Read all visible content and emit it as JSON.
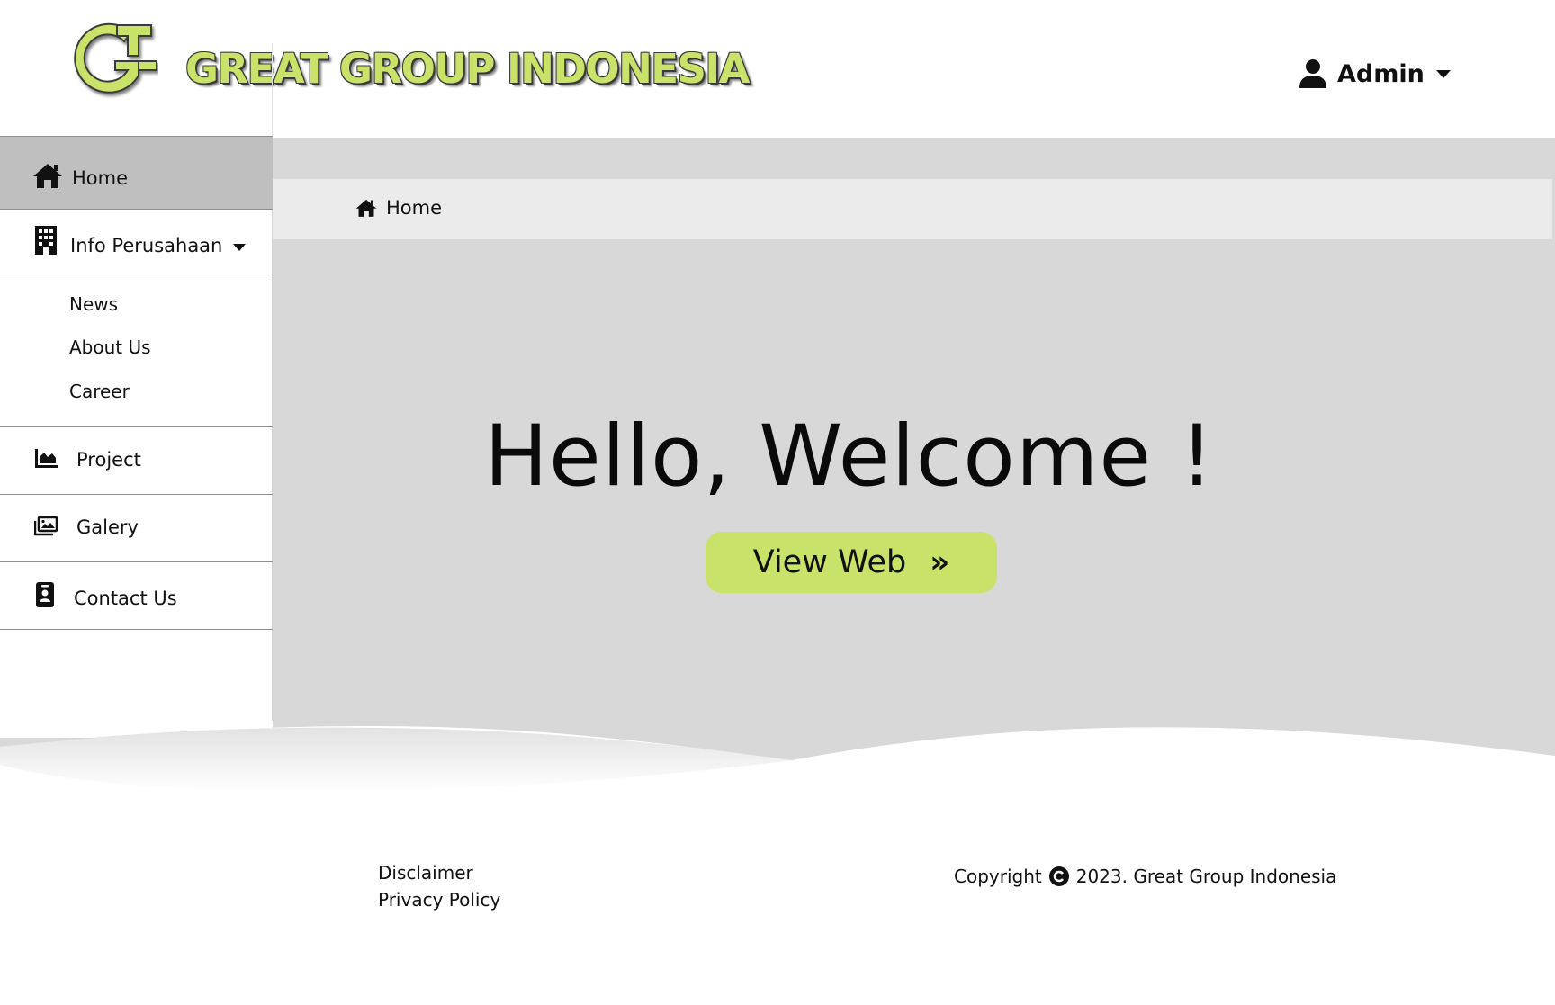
{
  "header": {
    "brand_name": "GREAT GROUP INDONESIA",
    "user_name": "Admin"
  },
  "sidebar": {
    "items": [
      {
        "label": "Home",
        "icon": "home-icon",
        "active": true
      },
      {
        "label": "Info Perusahaan",
        "icon": "building-icon"
      },
      {
        "label": "Project",
        "icon": "chart-area-icon"
      },
      {
        "label": "Galery",
        "icon": "images-icon"
      },
      {
        "label": "Contact Us",
        "icon": "id-badge-icon"
      }
    ],
    "submenu": [
      "News",
      "About Us",
      "Career"
    ]
  },
  "breadcrumb": {
    "label": "Home"
  },
  "hero": {
    "title": "Hello, Welcome !",
    "button_label": "View Web"
  },
  "footer": {
    "links": [
      "Disclaimer",
      "Privacy Policy"
    ],
    "copyright_prefix": "Copyright",
    "copyright_text": "2023. Great Group Indonesia"
  },
  "colors": {
    "accent": "#c9e26a",
    "sidebar_active": "#bfbfbf",
    "main_bg": "#d8d8d8",
    "breadcrumb_bg": "#ebebeb"
  }
}
